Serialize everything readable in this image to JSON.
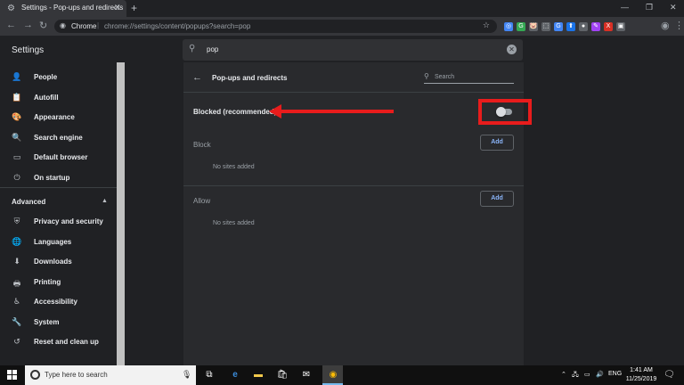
{
  "browser": {
    "tab_title": "Settings - Pop-ups and redirects",
    "tab_close": "✕",
    "new_tab": "+",
    "window_controls": [
      "—",
      "❐",
      "✕"
    ],
    "url_scheme": "Chrome",
    "url_separator": "|",
    "url_path": "chrome://settings/content/popups?search=pop",
    "extensions": [
      {
        "glyph": "◎",
        "color": "#4285f4"
      },
      {
        "glyph": "G",
        "color": "#34a853"
      },
      {
        "glyph": "🐷",
        "color": "#5f6368"
      },
      {
        "glyph": "⬚",
        "color": "#5f6368"
      },
      {
        "glyph": "G",
        "color": "#4285f4"
      },
      {
        "glyph": "⬆",
        "color": "#1a73e8"
      },
      {
        "glyph": "●",
        "color": "#5f6368"
      },
      {
        "glyph": "✎",
        "color": "#a142f4"
      },
      {
        "glyph": "X",
        "color": "#d93025"
      },
      {
        "glyph": "▣",
        "color": "#5f6368"
      }
    ]
  },
  "settings": {
    "title": "Settings",
    "search_query": "pop"
  },
  "sidebar": {
    "items": [
      {
        "label": "People",
        "icon": "person-icon",
        "glyph": "👤"
      },
      {
        "label": "Autofill",
        "icon": "clipboard-icon",
        "glyph": "📋"
      },
      {
        "label": "Appearance",
        "icon": "palette-icon",
        "glyph": "🎨"
      },
      {
        "label": "Search engine",
        "icon": "search-icon",
        "glyph": "🔍"
      },
      {
        "label": "Default browser",
        "icon": "browser-icon",
        "glyph": "▭"
      },
      {
        "label": "On startup",
        "icon": "power-icon",
        "glyph": "⏻"
      }
    ],
    "advanced_label": "Advanced",
    "advanced_caret": "▲",
    "advanced_items": [
      {
        "label": "Privacy and security",
        "icon": "shield-icon",
        "glyph": "⛨"
      },
      {
        "label": "Languages",
        "icon": "globe-icon",
        "glyph": "🌐"
      },
      {
        "label": "Downloads",
        "icon": "download-icon",
        "glyph": "⬇"
      },
      {
        "label": "Printing",
        "icon": "printer-icon",
        "glyph": "🖶"
      },
      {
        "label": "Accessibility",
        "icon": "accessibility-icon",
        "glyph": "♿"
      },
      {
        "label": "System",
        "icon": "wrench-icon",
        "glyph": "🔧"
      },
      {
        "label": "Reset and clean up",
        "icon": "history-icon",
        "glyph": "↺"
      }
    ]
  },
  "main": {
    "page_title": "Pop-ups and redirects",
    "search_placeholder": "Search",
    "blocked_label": "Blocked (recommended)",
    "toggle_on": false,
    "block_section": {
      "label": "Block",
      "add_label": "Add",
      "empty": "No sites added"
    },
    "allow_section": {
      "label": "Allow",
      "add_label": "Add",
      "empty": "No sites added"
    }
  },
  "taskbar": {
    "search_text": "Type here to search",
    "language": "ENG",
    "time": "1:41 AM",
    "date": "11/25/2019"
  },
  "colors": {
    "accent_blue": "#8ab4f8",
    "annotation_red": "#e81c1c"
  }
}
